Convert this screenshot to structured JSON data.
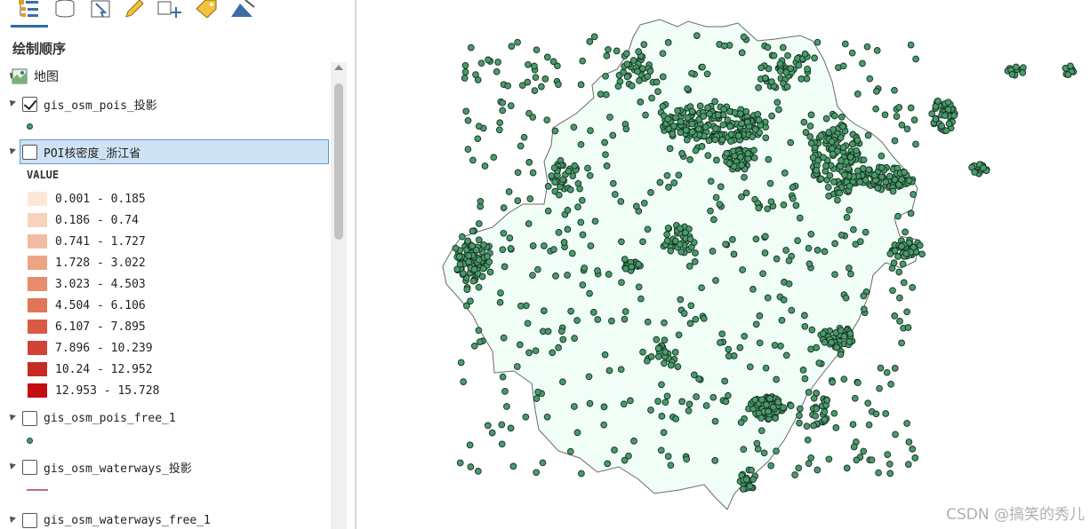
{
  "contents": {
    "title": "绘制顺序",
    "toolbar_icons": [
      "list-by-drawing-order-icon",
      "list-by-source-icon",
      "list-by-selection-icon",
      "list-by-editing-icon",
      "list-by-snapping-icon",
      "list-by-labeling-icon",
      "list-by-perspective-imagery-icon"
    ],
    "map": {
      "name": "地图"
    },
    "layers": [
      {
        "name": "gis_osm_pois_投影",
        "checked": true,
        "symbol": "point"
      },
      {
        "name": "POI核密度_浙江省",
        "checked": false,
        "symbol": "raster",
        "selected": true,
        "legend_heading": "VALUE",
        "legend": [
          {
            "label": "0.001 - 0.185",
            "color": "#fde6d8"
          },
          {
            "label": "0.186 - 0.74",
            "color": "#f8d2bd"
          },
          {
            "label": "0.741 - 1.727",
            "color": "#f2bca2"
          },
          {
            "label": "1.728 - 3.022",
            "color": "#eca584"
          },
          {
            "label": "3.023 - 4.503",
            "color": "#e78d6c"
          },
          {
            "label": "4.504 - 6.106",
            "color": "#e07658"
          },
          {
            "label": "6.107 - 7.895",
            "color": "#d95b45"
          },
          {
            "label": "7.896 - 10.239",
            "color": "#d04336"
          },
          {
            "label": "10.24 - 12.952",
            "color": "#c62a25"
          },
          {
            "label": "12.953 - 15.728",
            "color": "#c20d12"
          }
        ]
      },
      {
        "name": "gis_osm_pois_free_1",
        "checked": false,
        "symbol": "point"
      },
      {
        "name": "gis_osm_waterways_投影",
        "checked": false,
        "symbol": "line"
      },
      {
        "name": "gis_osm_waterways_free_1",
        "checked": false,
        "symbol": "line"
      }
    ]
  },
  "map_view": {
    "point_fill": "#4a9a6c",
    "point_stroke": "#15301f",
    "land_fill": "#f1fdf7",
    "boundary_stroke": "#6b6b6b"
  },
  "watermark": "CSDN @搞笑的秀儿"
}
